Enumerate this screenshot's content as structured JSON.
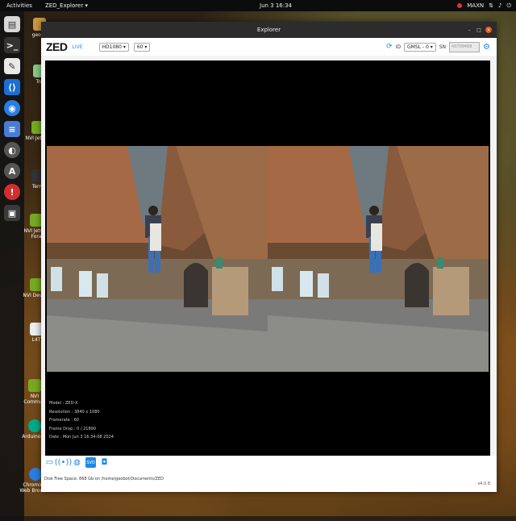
{
  "topbar": {
    "activities": "Activities",
    "app_menu": "ZED_Explorer ▾",
    "clock": "Jun 3  16:34",
    "power_mode": "MAXN"
  },
  "desktop_icons": [
    "geobo",
    "Tra",
    "NVI Jetson",
    "Term",
    "NVI Jetson Fora",
    "NVI Develo",
    "L4T",
    "NVI Commun",
    "Arduino ID",
    "Chromium Web Browser"
  ],
  "window": {
    "title": "Explorer",
    "logo": "ZED",
    "live_label": "LIVE",
    "resolution_select": "HD1080",
    "fps_select": "60",
    "id_label": "ID",
    "camera_select": "GMSL - 0",
    "sn_label": "SN",
    "sn_value": "40709468"
  },
  "info": {
    "model": "Model : ZED-X",
    "resolution": "Resolution : 3840 x 1080",
    "framerate": "Framerate : 60",
    "frame_drop": "Frame Drop : 0 / 21890",
    "date": "Date : Mon Jun 3 16:34:08 2024"
  },
  "bottom": {
    "disk": "Disk Free Space: 868 Gb  on /home/geobot/Documents/ZED",
    "version": "v4.0.8"
  },
  "colors": {
    "accent": "#1e88e5",
    "titlebar": "#2c2c2c"
  }
}
